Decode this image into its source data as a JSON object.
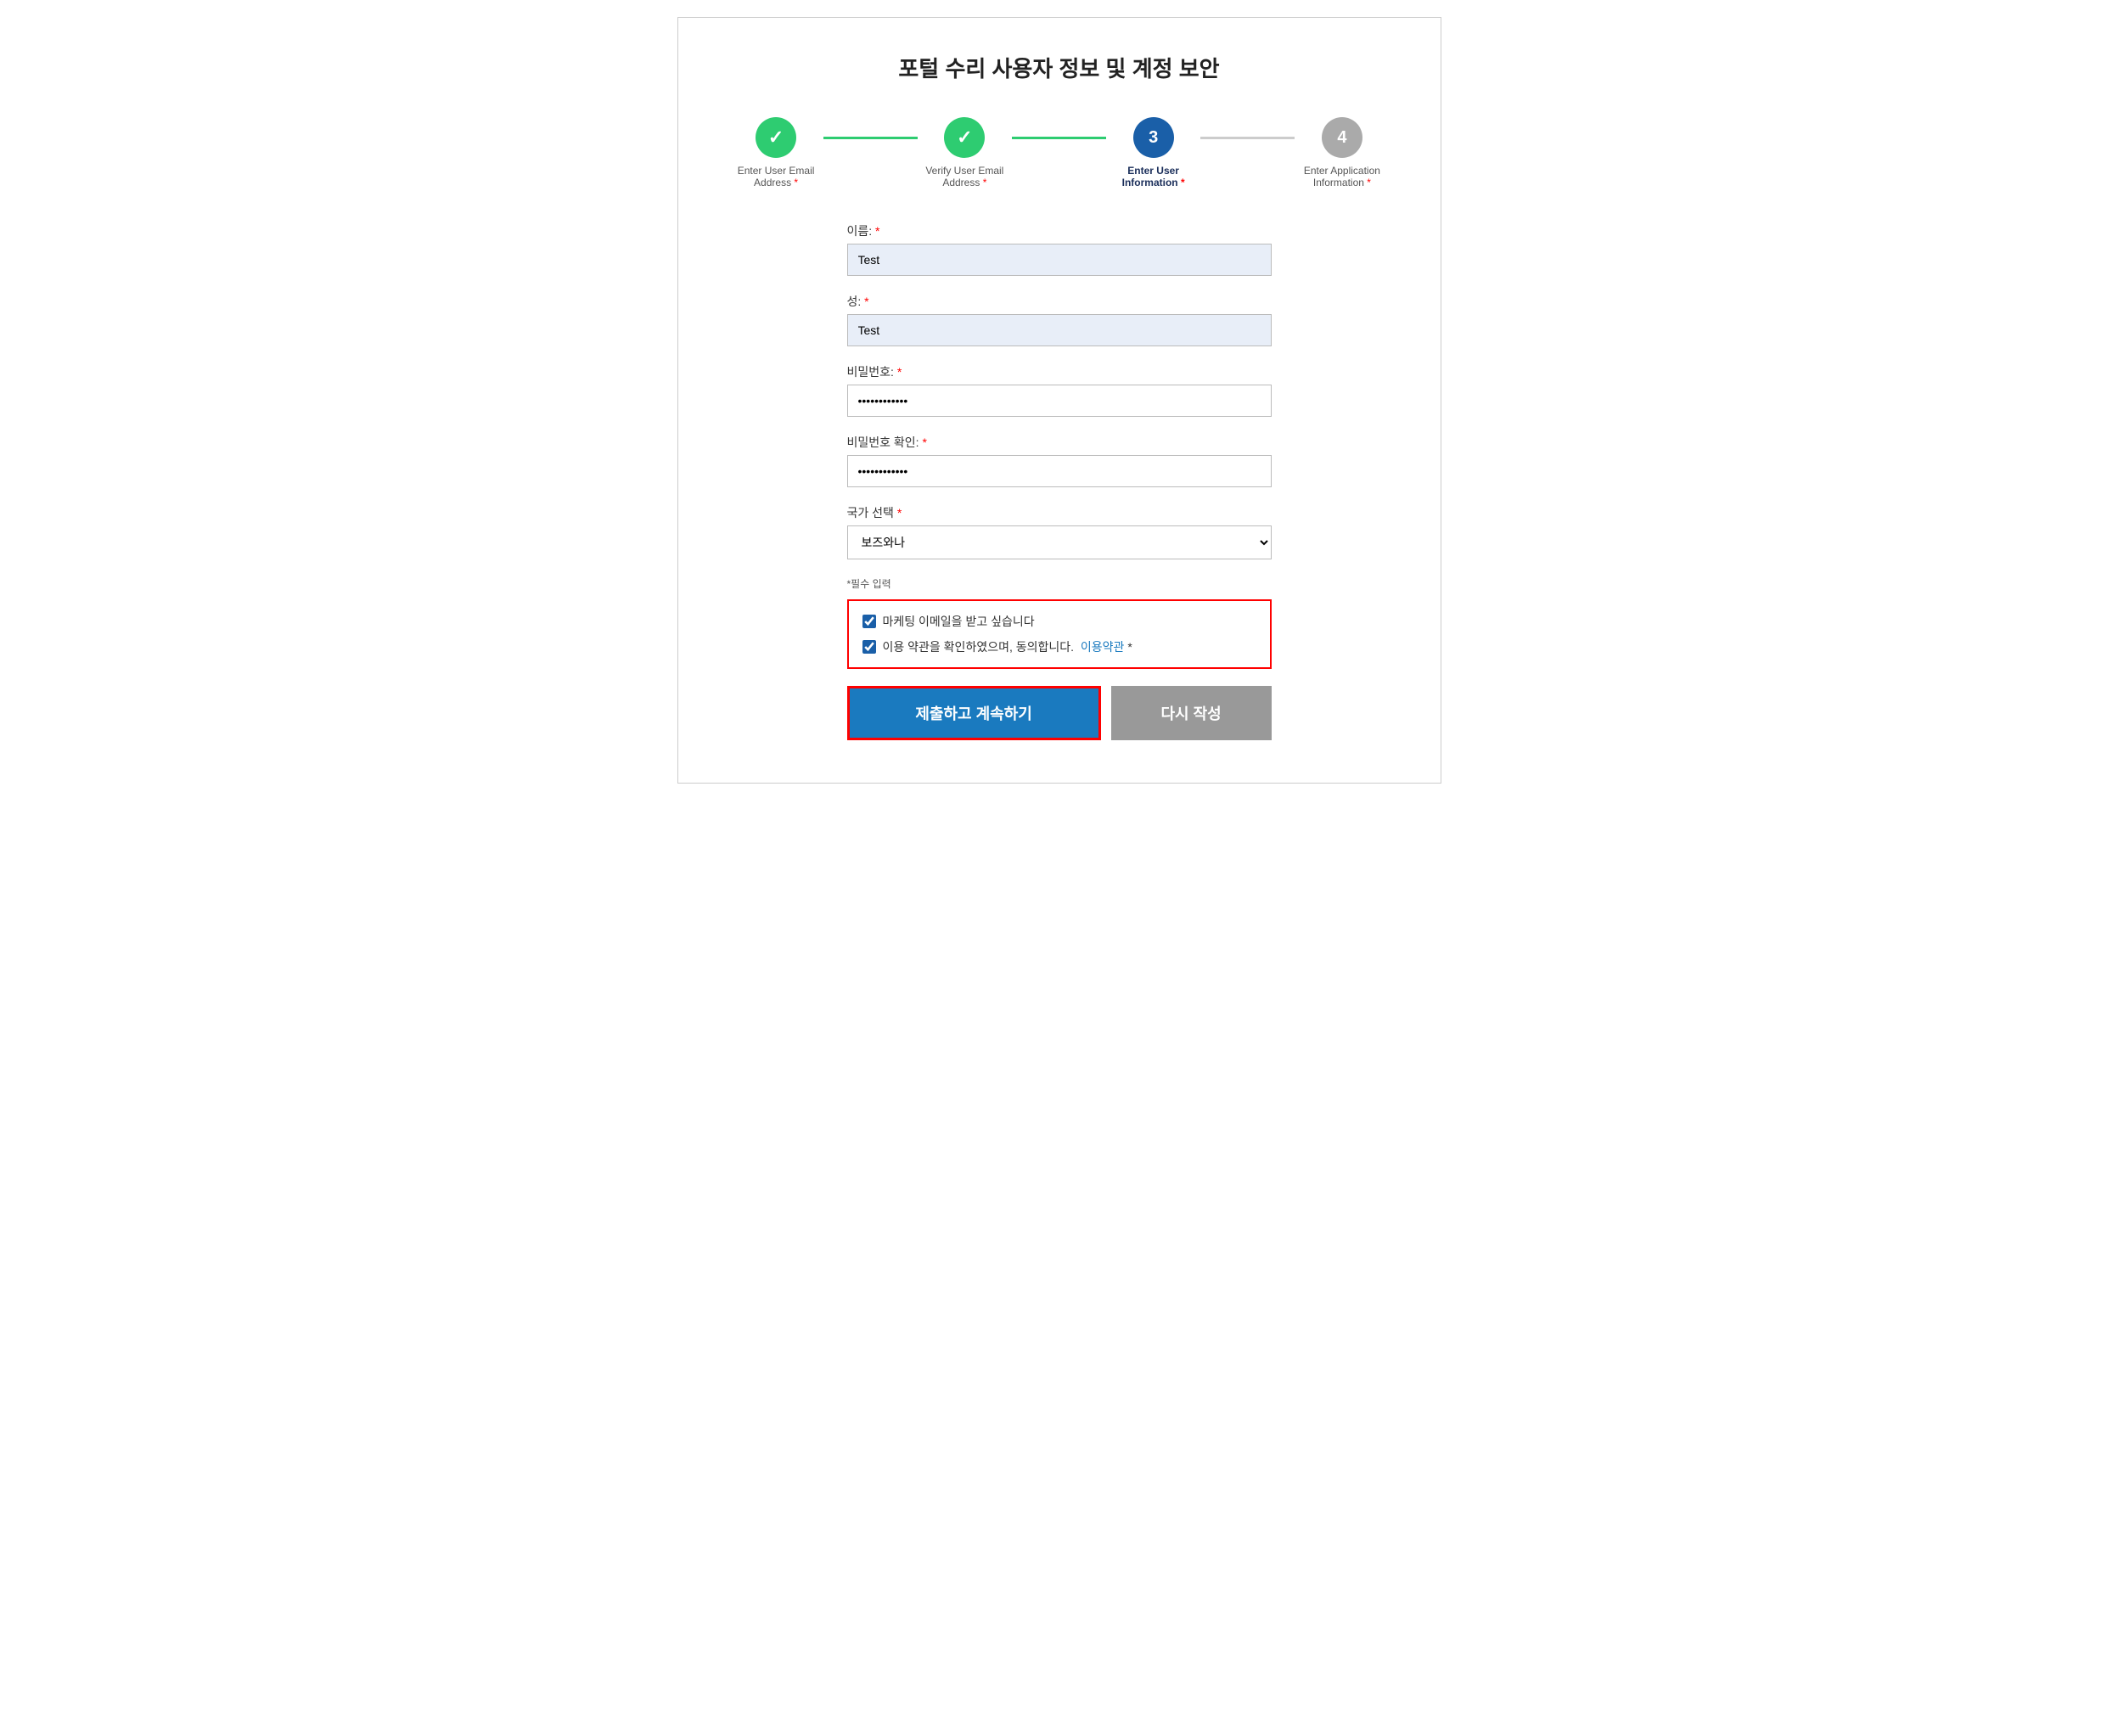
{
  "page": {
    "title": "포털 수리 사용자 정보 및 계정 보안"
  },
  "stepper": {
    "steps": [
      {
        "id": "step1",
        "number": "✓",
        "state": "completed",
        "label": "Enter User Email Address",
        "required": "*"
      },
      {
        "id": "step2",
        "number": "✓",
        "state": "completed",
        "label": "Verify User Email Address",
        "required": "*"
      },
      {
        "id": "step3",
        "number": "3",
        "state": "active",
        "label": "Enter User Information",
        "required": "*"
      },
      {
        "id": "step4",
        "number": "4",
        "state": "inactive",
        "label": "Enter Application Information",
        "required": "*"
      }
    ]
  },
  "form": {
    "firstName": {
      "label": "이름:",
      "required": "*",
      "value": "Test",
      "placeholder": ""
    },
    "lastName": {
      "label": "성:",
      "required": "*",
      "value": "Test",
      "placeholder": ""
    },
    "password": {
      "label": "비밀번호:",
      "required": "*",
      "value": "············",
      "placeholder": ""
    },
    "confirmPassword": {
      "label": "비밀번호 확인:",
      "required": "*",
      "value": "············",
      "placeholder": ""
    },
    "country": {
      "label": "국가 선택",
      "required": "*",
      "selected": "보즈와나",
      "options": [
        "보즈와나"
      ]
    },
    "requiredNote": "*필수 입력",
    "checkboxes": {
      "marketing": {
        "label": "마케팅 이메일을 받고 싶습니다",
        "checked": true
      },
      "terms": {
        "label": "이용 약관을 확인하였으며, 동의합니다.",
        "linkText": "이용약관",
        "required": "*",
        "checked": true
      }
    },
    "submitButton": "제출하고 계속하기",
    "resetButton": "다시 작성"
  }
}
